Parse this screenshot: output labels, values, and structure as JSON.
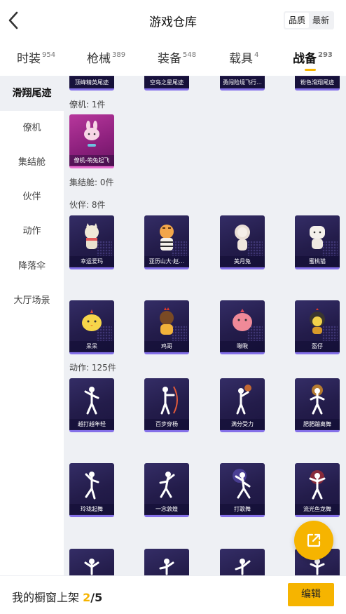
{
  "header": {
    "title": "游戏仓库",
    "back_icon": "chevron-left-icon",
    "sort_options": [
      "品质",
      "最新"
    ],
    "sort_active": "品质"
  },
  "tabs": [
    {
      "label": "时装",
      "count": "954"
    },
    {
      "label": "枪械",
      "count": "389"
    },
    {
      "label": "装备",
      "count": "548"
    },
    {
      "label": "载具",
      "count": "4"
    },
    {
      "label": "战备",
      "count": "293",
      "active": true
    }
  ],
  "sidebar": {
    "items": [
      "滑翔尾迹",
      "僚机",
      "集结舱",
      "伙伴",
      "动作",
      "降落伞",
      "大厅场景"
    ],
    "active": "滑翔尾迹"
  },
  "sections": {
    "trail_items": [
      "顶峰精英尾迹",
      "空岛之星尾迹",
      "勇闯险境飞行…",
      "粉色滑翔尾迹"
    ],
    "wingman": {
      "title": "僚机: 1件",
      "items": [
        "僚机-萌兔起飞"
      ]
    },
    "rally": {
      "title": "集结舱: 0件"
    },
    "partner": {
      "title": "伙伴: 8件",
      "items": [
        "幸运爱玛",
        "亚历山大·赵…",
        "美月兔",
        "蜜桃猫",
        "呆呆",
        "鸡哥",
        "啾啾",
        "盔仔"
      ]
    },
    "action": {
      "title": "动作: 125件",
      "items": [
        "越打越年轻",
        "百步穿杨",
        "满分受力",
        "肥肥蹦离舞",
        "玲珑起舞",
        "一念敦煌",
        "打歌舞",
        "流光鱼龙舞"
      ]
    }
  },
  "footer": {
    "text": "我的橱窗上架",
    "current": "2",
    "total": "/5",
    "edit_label": "编辑"
  },
  "fab": {
    "icon": "share-icon"
  },
  "colors": {
    "accent": "#f6b400",
    "card_dark": "#231c4a",
    "card_pink": "#8a1f7b",
    "card_border": "#8470e8"
  }
}
